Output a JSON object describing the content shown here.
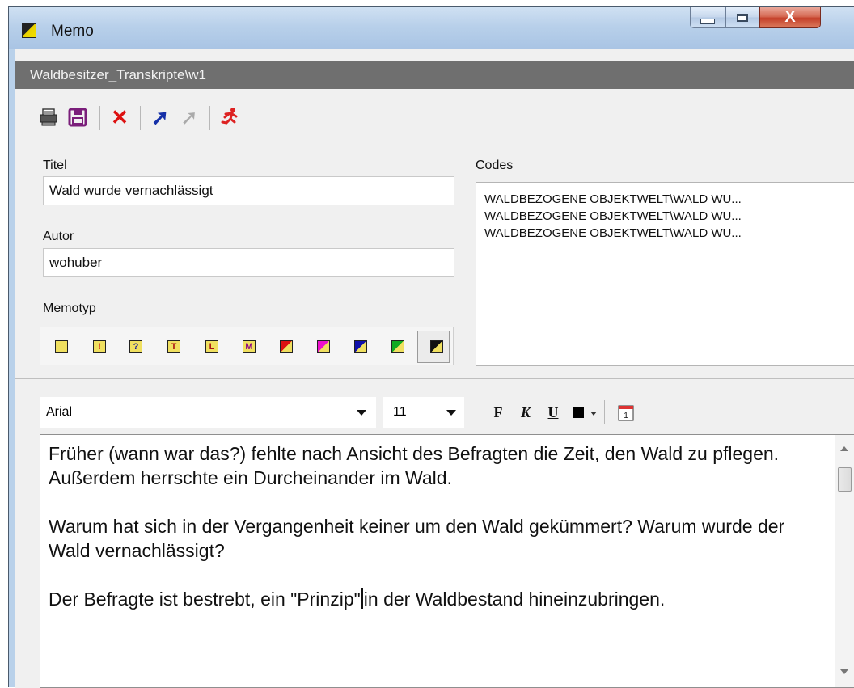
{
  "window": {
    "title": "Memo",
    "controls": {
      "minimize": "minimize",
      "maximize": "maximize",
      "close": "X"
    }
  },
  "path_header": "Waldbesitzer_Transkripte\\w1",
  "toolbar": [
    {
      "name": "print-icon",
      "glyph": "🖶"
    },
    {
      "name": "save-icon",
      "glyph": "💾"
    },
    {
      "name": "delete-icon",
      "glyph": "✕"
    },
    {
      "name": "jump-icon",
      "glyph": "↗"
    },
    {
      "name": "jump-disabled-icon",
      "glyph": "↗"
    },
    {
      "name": "run-icon",
      "glyph": "🏃"
    }
  ],
  "form": {
    "titel_label": "Titel",
    "titel_value": "Wald wurde vernachlässigt",
    "autor_label": "Autor",
    "autor_value": "wohuber",
    "memotyp_label": "Memotyp",
    "codes_label": "Codes",
    "codes": [
      "WALDBEZOGENE OBJEKTWELT\\WALD WU...",
      "WALDBEZOGENE OBJEKTWELT\\WALD WU...",
      "WALDBEZOGENE OBJEKTWELT\\WALD WU..."
    ]
  },
  "memotypes": [
    {
      "name": "memo-type-plain-icon",
      "glyph": "",
      "color": "#f0e060"
    },
    {
      "name": "memo-type-exclamation-icon",
      "glyph": "!",
      "color": "#f0e060",
      "accent": "#cc1111"
    },
    {
      "name": "memo-type-question-icon",
      "glyph": "?",
      "color": "#f0e060",
      "accent": "#1a1a99"
    },
    {
      "name": "memo-type-t-icon",
      "glyph": "T",
      "color": "#f0e060",
      "accent": "#aa1111"
    },
    {
      "name": "memo-type-l-icon",
      "glyph": "L",
      "color": "#f0e060",
      "accent": "#aa1111"
    },
    {
      "name": "memo-type-m-icon",
      "glyph": "M",
      "color": "#f0e060",
      "accent": "#880088"
    },
    {
      "name": "memo-type-red-icon",
      "glyph": "",
      "color": "#f0e060",
      "accent": "#dd1111"
    },
    {
      "name": "memo-type-magenta-icon",
      "glyph": "",
      "color": "#f0e060",
      "accent": "#ee11cc"
    },
    {
      "name": "memo-type-blue-icon",
      "glyph": "",
      "color": "#f0e060",
      "accent": "#1111aa"
    },
    {
      "name": "memo-type-green-icon",
      "glyph": "",
      "color": "#f0e060",
      "accent": "#11aa22"
    },
    {
      "name": "memo-type-black-icon",
      "glyph": "",
      "color": "#f0e060",
      "accent": "#111111",
      "selected": true
    }
  ],
  "format_toolbar": {
    "font": "Arial",
    "size": "11",
    "bold": "F",
    "italic": "K",
    "underline": "U",
    "color_swatch": "#000000",
    "date_icon": "1"
  },
  "editor": {
    "paragraphs": [
      "Früher (wann war das?) fehlte nach Ansicht des Befragten die Zeit, den Wald zu pflegen. Außerdem herrschte ein Durcheinander im Wald.",
      "Warum hat sich in der Vergangenheit keiner um den Wald gekümmert? Warum wurde der Wald vernachlässigt?",
      "Der Befragte ist bestrebt, ein \"Prinzip\"",
      "in der Waldbestand hineinzubringen."
    ]
  }
}
